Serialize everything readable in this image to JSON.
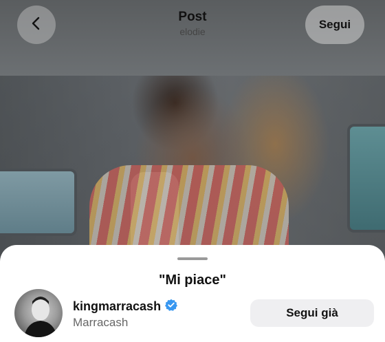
{
  "header": {
    "title": "Post",
    "subtitle": "elodie",
    "follow_label": "Segui",
    "back_icon": "chevron-left-icon"
  },
  "sheet": {
    "title": "\"Mi piace\"",
    "users": [
      {
        "username": "kingmarracash",
        "full_name": "Marracash",
        "verified": true,
        "action_label": "Segui già"
      }
    ]
  },
  "colors": {
    "verified_blue": "#3897f0",
    "sheet_bg": "#ffffff",
    "button_bg": "#efeff1"
  }
}
